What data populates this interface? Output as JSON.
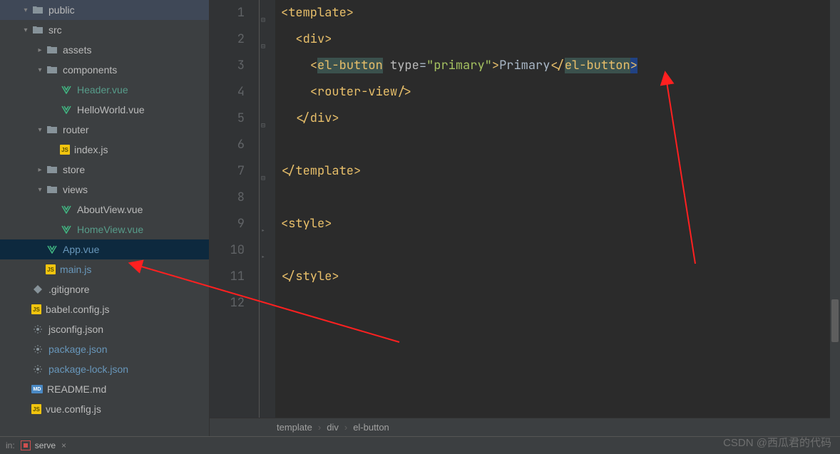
{
  "tree": {
    "public": "public",
    "src": "src",
    "assets": "assets",
    "components": "components",
    "header_vue": "Header.vue",
    "helloworld_vue": "HelloWorld.vue",
    "router": "router",
    "index_js": "index.js",
    "store": "store",
    "views": "views",
    "aboutview": "AboutView.vue",
    "homeview": "HomeView.vue",
    "app_vue": "App.vue",
    "main_js": "main.js",
    "gitignore": ".gitignore",
    "babel": "babel.config.js",
    "jsconfig": "jsconfig.json",
    "package": "package.json",
    "packagelock": "package-lock.json",
    "readme": "README.md",
    "vueconfig": "vue.config.js"
  },
  "code": {
    "l1": {
      "open_tag": "<template>"
    },
    "l2": {
      "open_tag": "<div>"
    },
    "l3": {
      "open": "<",
      "tag": "el-button",
      "sp": " ",
      "attr": "type",
      "eq": "=",
      "val": "\"primary\"",
      "close1": ">",
      "text": "Primary",
      "open2": "</",
      "tag2": "el-button",
      "close2": ">"
    },
    "l4": {
      "tag": "<router-view/>"
    },
    "l5": {
      "tag": "</div>"
    },
    "l7": {
      "tag": "</template>"
    },
    "l9": {
      "tag": "<style>"
    },
    "l11": {
      "tag": "</style>"
    }
  },
  "line_numbers": [
    "1",
    "2",
    "3",
    "4",
    "5",
    "6",
    "7",
    "8",
    "9",
    "10",
    "11",
    "12"
  ],
  "breadcrumb": {
    "a": "template",
    "b": "div",
    "c": "el-button"
  },
  "bottom": {
    "in": "in:",
    "serve": "serve"
  },
  "watermark": "CSDN @西瓜君的代码"
}
